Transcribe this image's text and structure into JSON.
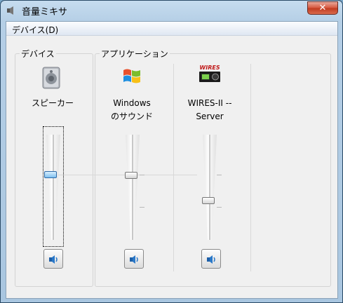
{
  "window": {
    "title": "音量ミキサ",
    "close_label": "✕"
  },
  "menu": {
    "device_label": "デバイス(D)"
  },
  "groups": {
    "device_label": "デバイス",
    "apps_label": "アプリケーション"
  },
  "channels": [
    {
      "name": "スピーカー",
      "volume_level": 0.62,
      "icon": "speaker-icon"
    },
    {
      "name_line1": "Windows",
      "name_line2": "のサウンド",
      "volume_level": 0.62,
      "icon": "windows-logo-icon"
    },
    {
      "name_line1": "WIRES-II --",
      "name_line2": "Server",
      "volume_level": 0.38,
      "icon": "wires-radio-icon",
      "icon_text": "WIRES"
    }
  ],
  "colors": {
    "accent": "#7fc0ef",
    "wires_red": "#c01818"
  }
}
